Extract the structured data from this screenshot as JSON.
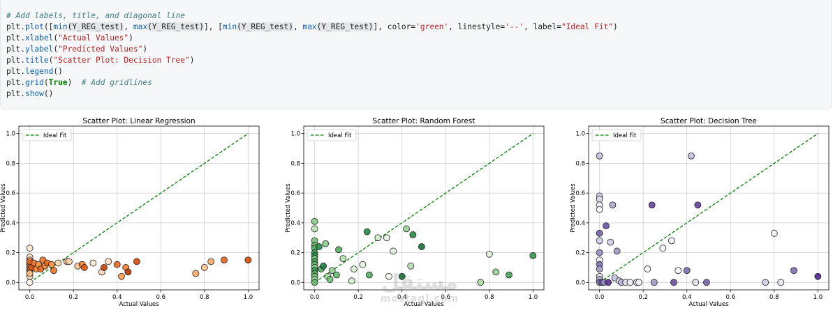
{
  "code": {
    "lines": [
      [
        {
          "t": "# Add labels, title, and diagonal line",
          "c": "c-cm"
        }
      ],
      [
        {
          "t": "plt.",
          "c": "c-pn"
        },
        {
          "t": "plot",
          "c": "c-nm"
        },
        {
          "t": "([",
          "c": "c-pn"
        },
        {
          "t": "min",
          "c": "c-nm"
        },
        {
          "t": "(Y_REG_test)",
          "c": "c-hl"
        },
        {
          "t": ", ",
          "c": "c-pn"
        },
        {
          "t": "max",
          "c": "c-nm"
        },
        {
          "t": "(Y_REG_test)",
          "c": "c-hl"
        },
        {
          "t": "], [",
          "c": "c-pn"
        },
        {
          "t": "min",
          "c": "c-nm"
        },
        {
          "t": "(Y_REG_test)",
          "c": "c-hl"
        },
        {
          "t": ", ",
          "c": "c-pn"
        },
        {
          "t": "max",
          "c": "c-nm"
        },
        {
          "t": "(Y_REG_test)",
          "c": "c-hl"
        },
        {
          "t": "], color=",
          "c": "c-pn"
        },
        {
          "t": "'green'",
          "c": "c-st"
        },
        {
          "t": ", linestyle=",
          "c": "c-pn"
        },
        {
          "t": "'--'",
          "c": "c-st"
        },
        {
          "t": ", label=",
          "c": "c-pn"
        },
        {
          "t": "\"Ideal Fit\"",
          "c": "c-st"
        },
        {
          "t": ")",
          "c": "c-pn"
        }
      ],
      [
        {
          "t": "plt.",
          "c": "c-pn"
        },
        {
          "t": "xlabel",
          "c": "c-nm"
        },
        {
          "t": "(",
          "c": "c-pn"
        },
        {
          "t": "\"Actual Values\"",
          "c": "c-st"
        },
        {
          "t": ")",
          "c": "c-pn"
        }
      ],
      [
        {
          "t": "plt.",
          "c": "c-pn"
        },
        {
          "t": "ylabel",
          "c": "c-nm"
        },
        {
          "t": "(",
          "c": "c-pn"
        },
        {
          "t": "\"Predicted Values\"",
          "c": "c-st"
        },
        {
          "t": ")",
          "c": "c-pn"
        }
      ],
      [
        {
          "t": "plt.",
          "c": "c-pn"
        },
        {
          "t": "title",
          "c": "c-nm"
        },
        {
          "t": "(",
          "c": "c-pn"
        },
        {
          "t": "\"Scatter Plot: Decision Tree\"",
          "c": "c-st"
        },
        {
          "t": ")",
          "c": "c-pn"
        }
      ],
      [
        {
          "t": "plt.",
          "c": "c-pn"
        },
        {
          "t": "legend",
          "c": "c-nm"
        },
        {
          "t": "()",
          "c": "c-pn"
        }
      ],
      [
        {
          "t": "plt.",
          "c": "c-pn"
        },
        {
          "t": "grid",
          "c": "c-nm"
        },
        {
          "t": "(",
          "c": "c-pn"
        },
        {
          "t": "True",
          "c": "c-kw"
        },
        {
          "t": ")  ",
          "c": "c-pn"
        },
        {
          "t": "# Add gridlines",
          "c": "c-cm"
        }
      ],
      [
        {
          "t": "plt.",
          "c": "c-pn"
        },
        {
          "t": "show",
          "c": "c-nm"
        },
        {
          "t": "()",
          "c": "c-pn"
        }
      ]
    ]
  },
  "watermark": {
    "arabic": "مستقل",
    "latin": "mostaql.com"
  },
  "chart_data": [
    {
      "type": "scatter",
      "title": "Scatter Plot: Linear Regression",
      "xlabel": "Actual Values",
      "ylabel": "Predicted Values",
      "xlim": [
        -0.05,
        1.05
      ],
      "ylim": [
        -0.05,
        1.05
      ],
      "xticks": [
        "0.0",
        "0.2",
        "0.4",
        "0.6",
        "0.8",
        "1.0"
      ],
      "yticks": [
        "0.0",
        "0.2",
        "0.4",
        "0.6",
        "0.8",
        "1.0"
      ],
      "grid": true,
      "legend": {
        "position": "top-left",
        "entries": [
          "Ideal Fit"
        ]
      },
      "ideal_line": {
        "x": [
          0,
          1
        ],
        "y": [
          0,
          1
        ],
        "color": "#008000",
        "style": "dashed"
      },
      "colormap": [
        "#fff5eb",
        "#fdd0a2",
        "#fd8d3c",
        "#d94801",
        "#7f2704"
      ],
      "points": [
        {
          "x": 0.0,
          "y": 0.0,
          "v": 0.0
        },
        {
          "x": 0.0,
          "y": 0.04,
          "v": 0.15
        },
        {
          "x": 0.0,
          "y": 0.23,
          "v": 0.1
        },
        {
          "x": 0.0,
          "y": 0.17,
          "v": 0.15
        },
        {
          "x": 0.0,
          "y": 0.15,
          "v": 0.2
        },
        {
          "x": 0.0,
          "y": 0.13,
          "v": 0.35
        },
        {
          "x": 0.0,
          "y": 0.12,
          "v": 0.3
        },
        {
          "x": 0.0,
          "y": 0.11,
          "v": 0.5
        },
        {
          "x": 0.0,
          "y": 0.1,
          "v": 0.4
        },
        {
          "x": 0.0,
          "y": 0.09,
          "v": 0.55
        },
        {
          "x": 0.0,
          "y": 0.08,
          "v": 0.45
        },
        {
          "x": 0.0,
          "y": 0.07,
          "v": 0.6
        },
        {
          "x": 0.0,
          "y": 0.06,
          "v": 0.3
        },
        {
          "x": 0.0,
          "y": 0.14,
          "v": 0.65
        },
        {
          "x": 0.01,
          "y": 0.1,
          "v": 0.7
        },
        {
          "x": 0.02,
          "y": 0.13,
          "v": 0.6
        },
        {
          "x": 0.03,
          "y": 0.09,
          "v": 0.55
        },
        {
          "x": 0.04,
          "y": 0.12,
          "v": 0.5
        },
        {
          "x": 0.05,
          "y": 0.09,
          "v": 0.65
        },
        {
          "x": 0.06,
          "y": 0.15,
          "v": 0.6
        },
        {
          "x": 0.07,
          "y": 0.11,
          "v": 0.55
        },
        {
          "x": 0.08,
          "y": 0.13,
          "v": 0.65
        },
        {
          "x": 0.1,
          "y": 0.12,
          "v": 0.5
        },
        {
          "x": 0.11,
          "y": 0.08,
          "v": 0.6
        },
        {
          "x": 0.13,
          "y": 0.13,
          "v": 0.2
        },
        {
          "x": 0.17,
          "y": 0.14,
          "v": 0.35
        },
        {
          "x": 0.18,
          "y": 0.14,
          "v": 0.2
        },
        {
          "x": 0.22,
          "y": 0.11,
          "v": 0.3
        },
        {
          "x": 0.24,
          "y": 0.12,
          "v": 0.55
        },
        {
          "x": 0.25,
          "y": 0.1,
          "v": 0.7
        },
        {
          "x": 0.29,
          "y": 0.13,
          "v": 0.1
        },
        {
          "x": 0.33,
          "y": 0.07,
          "v": 0.2
        },
        {
          "x": 0.34,
          "y": 0.1,
          "v": 0.8
        },
        {
          "x": 0.36,
          "y": 0.14,
          "v": 0.15
        },
        {
          "x": 0.4,
          "y": 0.12,
          "v": 0.65
        },
        {
          "x": 0.42,
          "y": 0.04,
          "v": 0.45
        },
        {
          "x": 0.44,
          "y": 0.1,
          "v": 0.55
        },
        {
          "x": 0.45,
          "y": 0.07,
          "v": 0.85
        },
        {
          "x": 0.49,
          "y": 0.14,
          "v": 0.75
        },
        {
          "x": 0.76,
          "y": 0.06,
          "v": 0.4
        },
        {
          "x": 0.8,
          "y": 0.1,
          "v": 0.3
        },
        {
          "x": 0.83,
          "y": 0.14,
          "v": 0.4
        },
        {
          "x": 0.89,
          "y": 0.15,
          "v": 0.65
        },
        {
          "x": 1.0,
          "y": 0.15,
          "v": 0.75
        }
      ]
    },
    {
      "type": "scatter",
      "title": "Scatter Plot: Random Forest",
      "xlabel": "Actual Values",
      "ylabel": "Predicted Values",
      "xlim": [
        -0.05,
        1.05
      ],
      "ylim": [
        -0.05,
        1.05
      ],
      "xticks": [
        "0.0",
        "0.2",
        "0.4",
        "0.6",
        "0.8",
        "1.0"
      ],
      "yticks": [
        "0.0",
        "0.2",
        "0.4",
        "0.6",
        "0.8",
        "1.0"
      ],
      "grid": true,
      "legend": {
        "position": "top-left",
        "entries": [
          "Ideal Fit"
        ]
      },
      "ideal_line": {
        "x": [
          0,
          1
        ],
        "y": [
          0,
          1
        ],
        "color": "#008000",
        "style": "dashed"
      },
      "colormap": [
        "#f7fcf5",
        "#c7e9c0",
        "#74c476",
        "#238b45",
        "#00441b"
      ],
      "points": [
        {
          "x": 0.0,
          "y": 0.41,
          "v": 0.45
        },
        {
          "x": 0.0,
          "y": 0.36,
          "v": 0.3
        },
        {
          "x": 0.0,
          "y": 0.28,
          "v": 0.5
        },
        {
          "x": 0.0,
          "y": 0.25,
          "v": 0.55
        },
        {
          "x": 0.0,
          "y": 0.23,
          "v": 0.6
        },
        {
          "x": 0.0,
          "y": 0.2,
          "v": 0.7
        },
        {
          "x": 0.0,
          "y": 0.18,
          "v": 0.75
        },
        {
          "x": 0.0,
          "y": 0.16,
          "v": 0.5
        },
        {
          "x": 0.0,
          "y": 0.14,
          "v": 0.65
        },
        {
          "x": 0.0,
          "y": 0.12,
          "v": 0.55
        },
        {
          "x": 0.0,
          "y": 0.1,
          "v": 0.45
        },
        {
          "x": 0.0,
          "y": 0.08,
          "v": 0.7
        },
        {
          "x": 0.0,
          "y": 0.06,
          "v": 0.6
        },
        {
          "x": 0.0,
          "y": 0.04,
          "v": 0.5
        },
        {
          "x": 0.0,
          "y": 0.02,
          "v": 0.4
        },
        {
          "x": 0.0,
          "y": 0.0,
          "v": 0.55
        },
        {
          "x": 0.02,
          "y": 0.24,
          "v": 0.75
        },
        {
          "x": 0.03,
          "y": 0.09,
          "v": 0.6
        },
        {
          "x": 0.04,
          "y": 0.11,
          "v": 0.8
        },
        {
          "x": 0.05,
          "y": 0.26,
          "v": 0.45
        },
        {
          "x": 0.06,
          "y": 0.04,
          "v": 0.35
        },
        {
          "x": 0.07,
          "y": 0.02,
          "v": 0.5
        },
        {
          "x": 0.08,
          "y": 0.08,
          "v": 0.4
        },
        {
          "x": 0.1,
          "y": 0.05,
          "v": 0.55
        },
        {
          "x": 0.11,
          "y": 0.22,
          "v": 0.6
        },
        {
          "x": 0.13,
          "y": 0.16,
          "v": 0.3
        },
        {
          "x": 0.17,
          "y": 0.01,
          "v": 0.2
        },
        {
          "x": 0.18,
          "y": 0.09,
          "v": 0.15
        },
        {
          "x": 0.22,
          "y": 0.12,
          "v": 0.1
        },
        {
          "x": 0.24,
          "y": 0.34,
          "v": 0.75
        },
        {
          "x": 0.25,
          "y": 0.05,
          "v": 0.6
        },
        {
          "x": 0.29,
          "y": 0.3,
          "v": 0.2
        },
        {
          "x": 0.33,
          "y": 0.3,
          "v": 0.1
        },
        {
          "x": 0.34,
          "y": 0.04,
          "v": 0.05
        },
        {
          "x": 0.36,
          "y": 0.21,
          "v": 0.15
        },
        {
          "x": 0.4,
          "y": 0.04,
          "v": 0.85
        },
        {
          "x": 0.42,
          "y": 0.36,
          "v": 0.4
        },
        {
          "x": 0.44,
          "y": 0.11,
          "v": 0.3
        },
        {
          "x": 0.45,
          "y": 0.32,
          "v": 0.75
        },
        {
          "x": 0.49,
          "y": 0.24,
          "v": 0.85
        },
        {
          "x": 0.76,
          "y": 0.0,
          "v": 0.35
        },
        {
          "x": 0.8,
          "y": 0.19,
          "v": 0.1
        },
        {
          "x": 0.83,
          "y": 0.07,
          "v": 0.4
        },
        {
          "x": 0.89,
          "y": 0.05,
          "v": 0.65
        },
        {
          "x": 1.0,
          "y": 0.18,
          "v": 0.7
        }
      ]
    },
    {
      "type": "scatter",
      "title": "Scatter Plot: Decision Tree",
      "xlabel": "Actual Values",
      "ylabel": "Predicted Values",
      "xlim": [
        -0.05,
        1.05
      ],
      "ylim": [
        -0.05,
        1.05
      ],
      "xticks": [
        "0.0",
        "0.2",
        "0.4",
        "0.6",
        "0.8",
        "1.0"
      ],
      "yticks": [
        "0.0",
        "0.2",
        "0.4",
        "0.6",
        "0.8",
        "1.0"
      ],
      "grid": true,
      "legend": {
        "position": "top-left",
        "entries": [
          "Ideal Fit"
        ]
      },
      "ideal_line": {
        "x": [
          0,
          1
        ],
        "y": [
          0,
          1
        ],
        "color": "#008000",
        "style": "dashed"
      },
      "colormap": [
        "#fcfbfd",
        "#dadaeb",
        "#9e9ac8",
        "#6a51a3",
        "#3f007d"
      ],
      "points": [
        {
          "x": 0.0,
          "y": 0.85,
          "v": 0.35
        },
        {
          "x": 0.0,
          "y": 0.58,
          "v": 0.3
        },
        {
          "x": 0.0,
          "y": 0.56,
          "v": 0.25
        },
        {
          "x": 0.0,
          "y": 0.52,
          "v": 0.1
        },
        {
          "x": 0.0,
          "y": 0.49,
          "v": 0.05
        },
        {
          "x": 0.0,
          "y": 0.33,
          "v": 0.7
        },
        {
          "x": 0.0,
          "y": 0.28,
          "v": 0.3
        },
        {
          "x": 0.0,
          "y": 0.2,
          "v": 0.55
        },
        {
          "x": 0.0,
          "y": 0.15,
          "v": 0.1
        },
        {
          "x": 0.0,
          "y": 0.12,
          "v": 0.65
        },
        {
          "x": 0.0,
          "y": 0.09,
          "v": 0.5
        },
        {
          "x": 0.0,
          "y": 0.04,
          "v": 0.2
        },
        {
          "x": 0.0,
          "y": 0.02,
          "v": 0.4
        },
        {
          "x": 0.0,
          "y": 0.0,
          "v": 0.6
        },
        {
          "x": 0.01,
          "y": 0.0,
          "v": 0.75
        },
        {
          "x": 0.02,
          "y": 0.0,
          "v": 0.55
        },
        {
          "x": 0.03,
          "y": 0.38,
          "v": 0.75
        },
        {
          "x": 0.04,
          "y": 0.0,
          "v": 0.85
        },
        {
          "x": 0.05,
          "y": 0.27,
          "v": 0.3
        },
        {
          "x": 0.06,
          "y": 0.52,
          "v": 0.45
        },
        {
          "x": 0.07,
          "y": 0.03,
          "v": 0.35
        },
        {
          "x": 0.08,
          "y": 0.21,
          "v": 0.5
        },
        {
          "x": 0.09,
          "y": 0.01,
          "v": 0.2
        },
        {
          "x": 0.1,
          "y": 0.0,
          "v": 0.4
        },
        {
          "x": 0.12,
          "y": 0.0,
          "v": 0.2
        },
        {
          "x": 0.14,
          "y": 0.0,
          "v": 0.1
        },
        {
          "x": 0.17,
          "y": 0.0,
          "v": 0.15
        },
        {
          "x": 0.18,
          "y": 0.0,
          "v": 0.05
        },
        {
          "x": 0.22,
          "y": 0.09,
          "v": 0.05
        },
        {
          "x": 0.24,
          "y": 0.52,
          "v": 0.8
        },
        {
          "x": 0.25,
          "y": 0.0,
          "v": 0.5
        },
        {
          "x": 0.29,
          "y": 0.23,
          "v": 0.05
        },
        {
          "x": 0.33,
          "y": 0.28,
          "v": 0.1
        },
        {
          "x": 0.34,
          "y": 0.0,
          "v": 0.75
        },
        {
          "x": 0.36,
          "y": 0.08,
          "v": 0.05
        },
        {
          "x": 0.4,
          "y": 0.08,
          "v": 0.65
        },
        {
          "x": 0.42,
          "y": 0.85,
          "v": 0.35
        },
        {
          "x": 0.44,
          "y": 0.0,
          "v": 0.2
        },
        {
          "x": 0.45,
          "y": 0.52,
          "v": 0.8
        },
        {
          "x": 0.49,
          "y": 0.0,
          "v": 0.7
        },
        {
          "x": 0.76,
          "y": 0.0,
          "v": 0.3
        },
        {
          "x": 0.8,
          "y": 0.33,
          "v": 0.05
        },
        {
          "x": 0.83,
          "y": 0.0,
          "v": 0.15
        },
        {
          "x": 0.89,
          "y": 0.08,
          "v": 0.65
        },
        {
          "x": 1.0,
          "y": 0.04,
          "v": 0.9
        }
      ]
    }
  ]
}
